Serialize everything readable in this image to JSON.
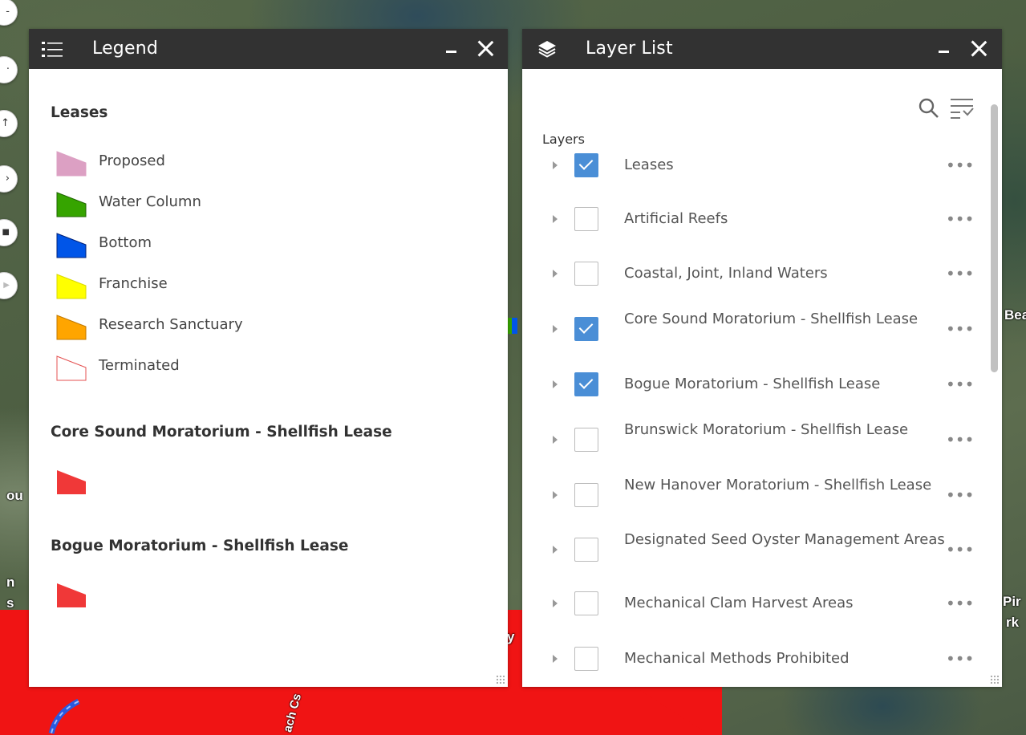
{
  "map": {
    "labels": [
      "ou",
      "n",
      "s",
      "Bea",
      "Pir",
      "rk",
      "y",
      "ach Cs"
    ]
  },
  "legend_panel": {
    "title": "Legend",
    "icon": "legend-list-icon",
    "sections": [
      {
        "title": "Leases",
        "items": [
          {
            "label": "Proposed",
            "fill": "#dca0c3",
            "stroke": "#dca0c3"
          },
          {
            "label": "Water Column",
            "fill": "#36a400",
            "stroke": "#1f6600"
          },
          {
            "label": "Bottom",
            "fill": "#0055e8",
            "stroke": "#00227a"
          },
          {
            "label": "Franchise",
            "fill": "#ffff00",
            "stroke": "#d8d800"
          },
          {
            "label": "Research Sanctuary",
            "fill": "#ffa500",
            "stroke": "#c07800"
          },
          {
            "label": "Terminated",
            "fill": "#ffffff",
            "stroke": "#e45050"
          }
        ]
      },
      {
        "title": "Core Sound Moratorium - Shellfish Lease",
        "items": [
          {
            "label": "",
            "fill": "#f03838",
            "stroke": "#f03838"
          }
        ]
      },
      {
        "title": "Bogue Moratorium - Shellfish Lease",
        "items": [
          {
            "label": "",
            "fill": "#f03838",
            "stroke": "#f03838"
          }
        ]
      }
    ]
  },
  "layer_panel": {
    "title": "Layer List",
    "icon": "layers-stack-icon",
    "layers_label": "Layers",
    "more_glyph": "•••",
    "layers": [
      {
        "name": "Leases",
        "checked": true
      },
      {
        "name": "Artificial Reefs",
        "checked": false
      },
      {
        "name": "Coastal, Joint, Inland Waters",
        "checked": false
      },
      {
        "name": "Core Sound Moratorium - Shellfish Lease",
        "checked": true
      },
      {
        "name": "Bogue Moratorium - Shellfish Lease",
        "checked": true
      },
      {
        "name": "Brunswick Moratorium - Shellfish Lease",
        "checked": false
      },
      {
        "name": "New Hanover Moratorium - Shellfish Lease",
        "checked": false
      },
      {
        "name": "Designated Seed Oyster Management Areas",
        "checked": false
      },
      {
        "name": "Mechanical Clam Harvest Areas",
        "checked": false
      },
      {
        "name": "Mechanical Methods Prohibited",
        "checked": false
      }
    ]
  },
  "colors": {
    "header_bg": "#323232",
    "checkbox_checked": "#4a8ed6",
    "moratorium_red": "#f01414"
  }
}
